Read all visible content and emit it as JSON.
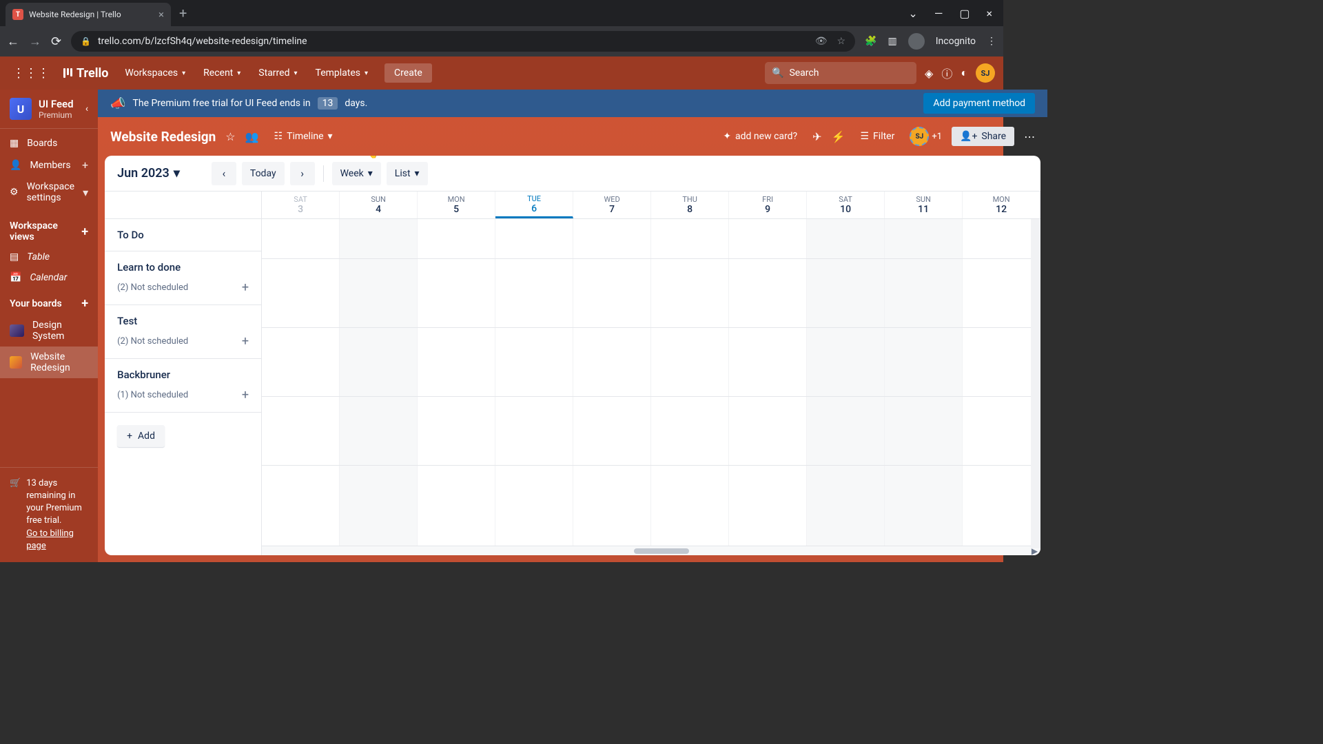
{
  "browser": {
    "tab_title": "Website Redesign | Trello",
    "url": "trello.com/b/lzcfSh4q/website-redesign/timeline",
    "profile": "Incognito"
  },
  "topbar": {
    "logo": "Trello",
    "items": [
      "Workspaces",
      "Recent",
      "Starred",
      "Templates"
    ],
    "create": "Create",
    "search_placeholder": "Search",
    "avatar_initials": "SJ"
  },
  "sidebar": {
    "workspace": {
      "badge": "U",
      "name": "UI Feed",
      "plan": "Premium"
    },
    "nav": {
      "boards": "Boards",
      "members": "Members",
      "settings": "Workspace settings"
    },
    "views_heading": "Workspace views",
    "views": [
      "Table",
      "Calendar"
    ],
    "your_boards_heading": "Your boards",
    "boards": [
      {
        "name": "Design System"
      },
      {
        "name": "Website Redesign"
      }
    ],
    "trial": "13 days remaining in your Premium free trial.",
    "trial_link": "Go to billing page"
  },
  "banner": {
    "text_pre": "The Premium free trial for UI Feed ends in",
    "days": "13",
    "text_post": "days.",
    "cta": "Add payment method"
  },
  "board_header": {
    "title": "Website Redesign",
    "view_label": "Timeline",
    "butler_hint": "add new card?",
    "filter": "Filter",
    "member_plus": "+1",
    "share": "Share",
    "avatar_initials": "SJ"
  },
  "timeline": {
    "month": "Jun 2023",
    "today": "Today",
    "range": "Week",
    "grouping": "List",
    "days": [
      {
        "dow": "SAT",
        "num": "3",
        "dim": true
      },
      {
        "dow": "SUN",
        "num": "4",
        "weekend": true
      },
      {
        "dow": "MON",
        "num": "5"
      },
      {
        "dow": "TUE",
        "num": "6",
        "today": true
      },
      {
        "dow": "WED",
        "num": "7"
      },
      {
        "dow": "THU",
        "num": "8"
      },
      {
        "dow": "FRI",
        "num": "9"
      },
      {
        "dow": "SAT",
        "num": "10",
        "weekend": true
      },
      {
        "dow": "SUN",
        "num": "11",
        "weekend": true
      },
      {
        "dow": "MON",
        "num": "12"
      }
    ],
    "lanes": [
      {
        "title": "To Do",
        "unscheduled": null
      },
      {
        "title": "Learn to done",
        "unscheduled": "(2) Not scheduled"
      },
      {
        "title": "Test",
        "unscheduled": "(2) Not scheduled"
      },
      {
        "title": "Backbruner",
        "unscheduled": "(1) Not scheduled"
      }
    ],
    "add": "Add"
  }
}
